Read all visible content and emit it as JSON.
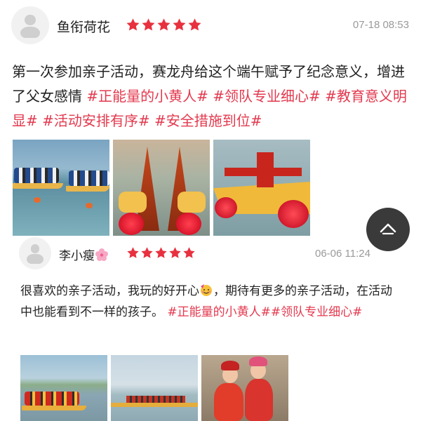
{
  "reviews": [
    {
      "user_name": "鱼衔荷花",
      "rating": 5,
      "time": "07-18 08:53",
      "text": "第一次参加亲子活动，赛龙舟给这个端午赋予了纪念意义，增进了父女感情 ",
      "tags": [
        "#正能量的小黄人#",
        "#领队专业细心#",
        "#教育意义明显#",
        "#活动安排有序#",
        "#安全措施到位#"
      ],
      "photos": [
        "dragon-boat-race-photo",
        "dragon-heads-photo",
        "dragon-boat-photo"
      ]
    },
    {
      "user_name": "李小瘦",
      "name_emoji": "cherry-blossom-icon",
      "rating": 5,
      "time": "06-06 11:24",
      "text_before_emoji": "很喜欢的亲子活动，我玩的好开心",
      "emoji": "party-face-icon",
      "text_after_emoji": "，期待有更多的亲子活动，在活动中也能看到不一样的孩子。",
      "tags": [
        "#正能量的小黄人#",
        "#领队专业细心#"
      ],
      "photos": [
        "team-rowing-photo",
        "lake-boats-photo",
        "kids-in-boat-photo"
      ]
    }
  ],
  "colors": {
    "star": "#e8313f",
    "tag": "#e3394e",
    "time": "#9a9a9a",
    "scroll_button": "#3a3a3a"
  },
  "scroll_top_icon": "chevron-up-icon"
}
